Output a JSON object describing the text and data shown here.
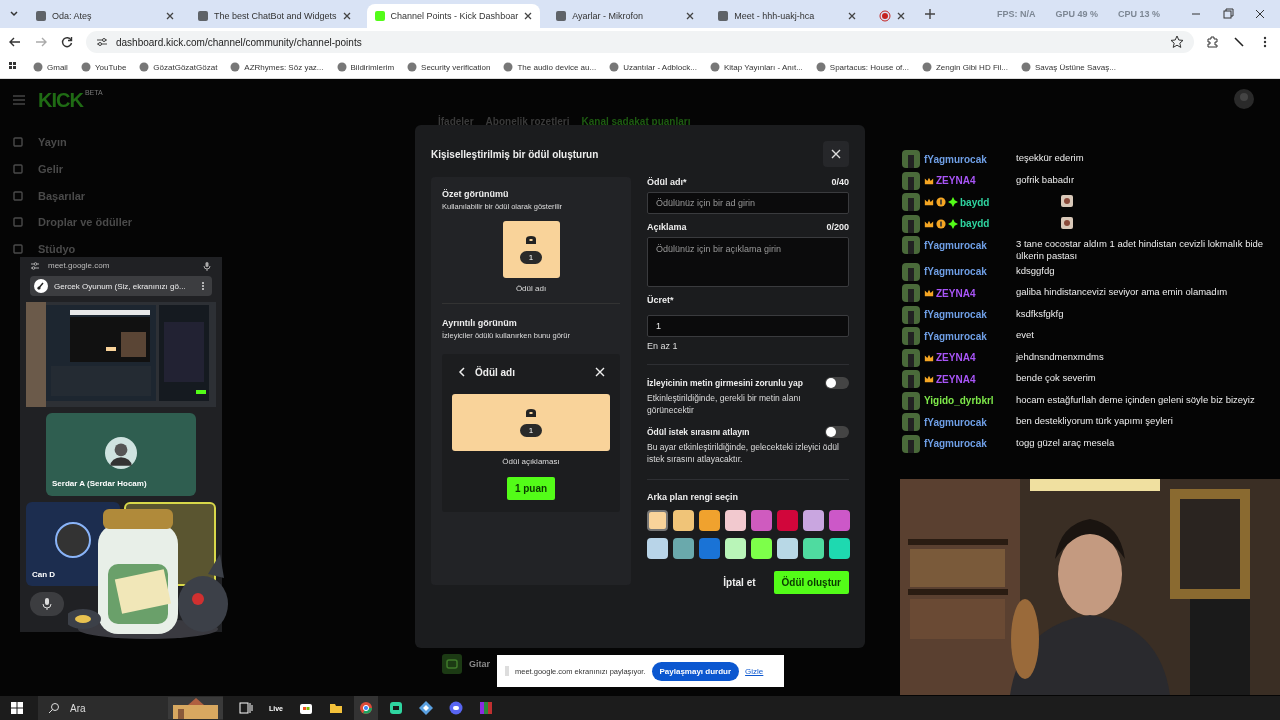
{
  "browser": {
    "tabs": [
      {
        "kind": "page",
        "title": "Oda: Ateş",
        "selected": false
      },
      {
        "kind": "page",
        "title": "The best ChatBot and Widgets",
        "selected": false
      },
      {
        "kind": "page",
        "title": "Channel Points - Kick Dashboar",
        "selected": true
      },
      {
        "kind": "page",
        "title": "Ayarlar - Mikrofon",
        "selected": false
      },
      {
        "kind": "page",
        "title": "Meet - hhh-uakj-hca",
        "selected": false
      },
      {
        "kind": "recording",
        "selected": false
      }
    ],
    "stats": [
      "FPS: N/A",
      "GPU 49 %",
      "CPU 13 %"
    ],
    "address": "dashboard.kick.com/channel/community/channel-points",
    "bookmarks": [
      "Gmail",
      "YouTube",
      "GözatGözatGözat",
      "AZRhymes: Söz yaz...",
      "Bildirimlerim",
      "Security verification",
      "The audio device au...",
      "Uzantılar - Adblock...",
      "Kitap Yayınları - Anıt...",
      "Spartacus: House of...",
      "Zengin Gibi HD Fil...",
      "Savaş Üstüne Savaş..."
    ]
  },
  "sidebar": {
    "logo": "KICK",
    "logo_badge": "BETA",
    "items": [
      {
        "label": "Yayın"
      },
      {
        "label": "Gelir"
      },
      {
        "label": "Başarılar"
      },
      {
        "label": "Droplar ve ödüller"
      },
      {
        "label": "Stüdyo"
      }
    ]
  },
  "page_tabs": [
    {
      "label": "İfadeler",
      "selected": false
    },
    {
      "label": "Abonelik rozetleri",
      "selected": false
    },
    {
      "label": "Kanal sadakat puanları",
      "selected": true
    }
  ],
  "reward_item": "Gitar",
  "modal": {
    "title": "Kişiselleştirilmiş bir ödül oluşturun",
    "summary": {
      "title": "Özet görünümü",
      "subtitle": "Kullanılabilir bir ödül olarak gösterilir",
      "cost": "1",
      "name": "Ödül adı"
    },
    "detail": {
      "title": "Ayrıntılı görünüm",
      "subtitle": "İzleyiciler ödülü kullanırken bunu görür",
      "header": "Ödül adı",
      "cost": "1",
      "description": "Ödül açıklaması",
      "button": "1 puan"
    },
    "name_field": {
      "label": "Ödül adı*",
      "count": "0/40",
      "placeholder": "Ödülünüz için bir ad girin"
    },
    "description_field": {
      "label": "Açıklama",
      "count": "0/200",
      "placeholder": "Ödülünüz için bir açıklama girin"
    },
    "cost_field": {
      "label": "Ücret*",
      "value": "1",
      "hint": "En az 1"
    },
    "toggles": [
      {
        "label": "İzleyicinin metin girmesini zorunlu yap",
        "description": "Etkinleştirildiğinde, gerekli bir metin alanı görünecektir",
        "on": false
      },
      {
        "label": "Ödül istek sırasını atlayın",
        "description": "Bu ayar etkinleştirildiğinde, gelecekteki izleyici ödül istek sırasını atlayacaktır.",
        "on": false
      }
    ],
    "color_label": "Arka plan rengi seçin",
    "colors": [
      {
        "color": "#f9d39a",
        "selected": true
      },
      {
        "color": "#f0c478",
        "selected": false
      },
      {
        "color": "#f0a22e",
        "selected": false
      },
      {
        "color": "#f2c9cf",
        "selected": false
      },
      {
        "color": "#cf5bbf",
        "selected": false
      },
      {
        "color": "#d1063b",
        "selected": false
      },
      {
        "color": "#c9a6e0",
        "selected": false
      },
      {
        "color": "#cc58c8",
        "selected": false
      },
      {
        "color": "#b8d4e8",
        "selected": false
      },
      {
        "color": "#6aa9ac",
        "selected": false
      },
      {
        "color": "#1a73d6",
        "selected": false
      },
      {
        "color": "#b9f5b8",
        "selected": false
      },
      {
        "color": "#7dff4a",
        "selected": false
      },
      {
        "color": "#b8d8e6",
        "selected": false
      },
      {
        "color": "#4fdba0",
        "selected": false
      },
      {
        "color": "#1ed9b0",
        "selected": false
      }
    ],
    "cancel": "İptal et",
    "submit": "Ödül oluştur"
  },
  "meet": {
    "host": "meet.google.com",
    "presenting": "Gercek Oyunum (Siz, ekranınızı gö...",
    "tiles": [
      "Serdar A (Serdar Hocam)",
      "Can D"
    ]
  },
  "chat": [
    {
      "user": "fYagmurocak",
      "color": "#6f9fe6",
      "kind": "text",
      "message": "teşekkür ederim"
    },
    {
      "user": "ZEYNA4",
      "color": "#a855f7",
      "badges": [
        {
          "kind": "crown"
        }
      ],
      "kind": "text",
      "message": "gofrik babadır"
    },
    {
      "user": "baydd",
      "color": "#2fd5a0",
      "badges": [
        {
          "kind": "crown"
        },
        {
          "kind": "coin"
        },
        {
          "kind": "gem"
        }
      ],
      "kind": "emote"
    },
    {
      "user": "baydd",
      "color": "#2fd5a0",
      "badges": [
        {
          "kind": "crown"
        },
        {
          "kind": "coin"
        },
        {
          "kind": "gem"
        }
      ],
      "kind": "emote"
    },
    {
      "user": "fYagmurocak",
      "color": "#6f9fe6",
      "kind": "text",
      "message": "3 tane cocostar aldım 1 adet hindistan cevizli lokmalık bide ülkerin pastası"
    },
    {
      "user": "fYagmurocak",
      "color": "#6f9fe6",
      "kind": "text",
      "message": "kdsggfdg"
    },
    {
      "user": "ZEYNA4",
      "color": "#a855f7",
      "badges": [
        {
          "kind": "crown"
        }
      ],
      "kind": "text",
      "message": "galiba hindistancevizi seviyor ama emin olamadım"
    },
    {
      "user": "fYagmurocak",
      "color": "#6f9fe6",
      "kind": "text",
      "message": "ksdfksfgkfg"
    },
    {
      "user": "fYagmurocak",
      "color": "#6f9fe6",
      "kind": "text",
      "message": "evet"
    },
    {
      "user": "ZEYNA4",
      "color": "#a855f7",
      "badges": [
        {
          "kind": "crown"
        }
      ],
      "kind": "text",
      "message": "jehdnsndmenxmdms"
    },
    {
      "user": "ZEYNA4",
      "color": "#a855f7",
      "badges": [
        {
          "kind": "crown"
        }
      ],
      "kind": "text",
      "message": "bende çok severim"
    },
    {
      "user": "Yigido_dyrbkrl",
      "color": "#7ee84a",
      "kind": "text",
      "message": "hocam estağfurllah deme içinden geleni söyle biz bizeyiz"
    },
    {
      "user": "fYagmurocak",
      "color": "#6f9fe6",
      "kind": "text",
      "message": "ben destekliyorum türk yapımı şeyleri"
    },
    {
      "user": "fYagmurocak",
      "color": "#6f9fe6",
      "kind": "text",
      "message": "togg güzel araç mesela"
    }
  ],
  "share_bar": {
    "message": "meet.google.com ekranınızı paylaşıyor.",
    "stop": "Paylaşmayı durdur",
    "hide": "Gizle"
  },
  "taskbar": {
    "search_placeholder": "Ara",
    "widget": "Live"
  }
}
